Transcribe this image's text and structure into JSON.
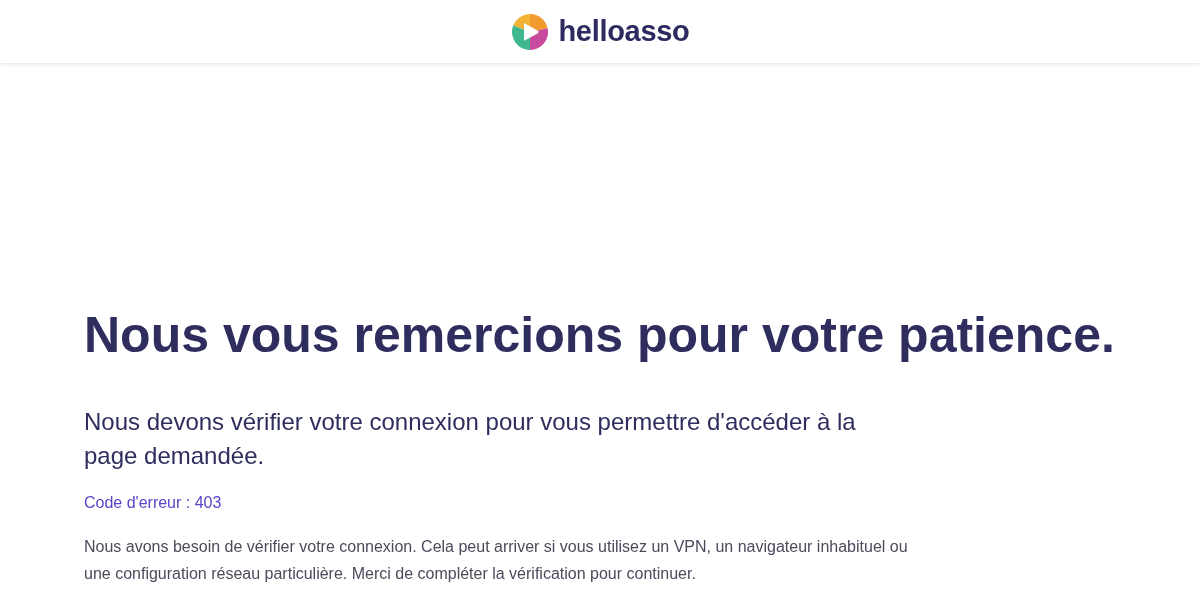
{
  "header": {
    "logo": "helloasso"
  },
  "main": {
    "title": "Nous vous remercions pour votre patience.",
    "subtitle": "Nous devons vérifier votre connexion pour vous permettre d'accéder à la page demandée.",
    "error_code": "Code d'erreur : 403",
    "description": "Nous avons besoin de vérifier votre connexion. Cela peut arriver si vous utilisez un VPN, un navigateur inhabituel ou une configuration réseau particulière. Merci de compléter la vérification pour continuer."
  }
}
